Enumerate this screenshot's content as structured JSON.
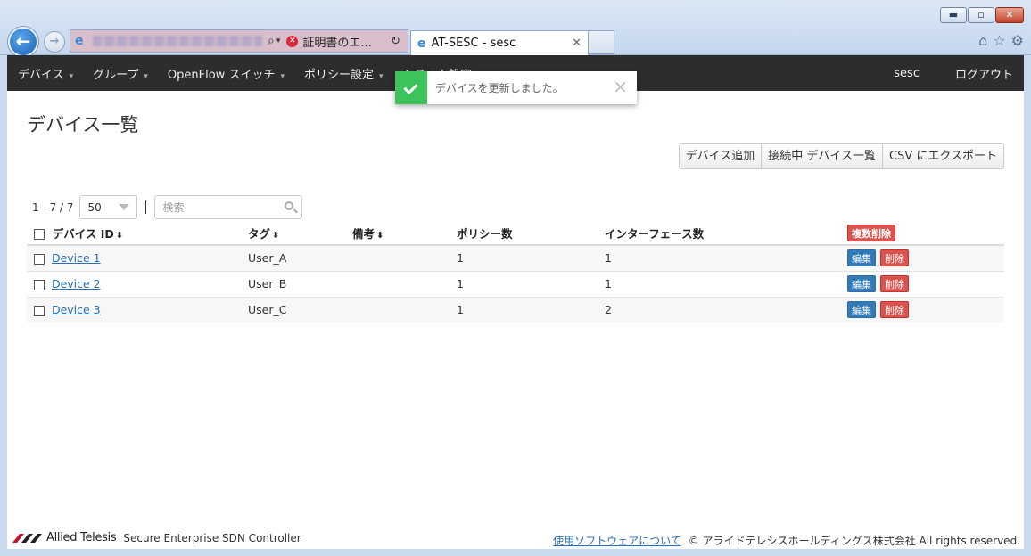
{
  "browser": {
    "window_controls": {
      "minimize": "▬",
      "maximize": "▫",
      "close": "✕"
    },
    "address_bar": {
      "cert_error_label": "証明書のエ...",
      "search_glyph": "⌕",
      "dropdown_glyph": "▾",
      "refresh_glyph": "↻",
      "error_glyph": "✕"
    },
    "tab": {
      "title": "AT-SESC - sesc",
      "close_glyph": "✕"
    },
    "tools": {
      "home": "⌂",
      "favorites": "☆",
      "settings": "⚙"
    }
  },
  "navbar": {
    "menu": [
      {
        "label": "デバイス"
      },
      {
        "label": "グループ"
      },
      {
        "label": "OpenFlow スイッチ"
      },
      {
        "label": "ポリシー設定"
      },
      {
        "label": "システム設定"
      }
    ],
    "user": "sesc",
    "logout": "ログアウト"
  },
  "toast": {
    "message": "デバイスを更新しました。",
    "close_glyph": "×"
  },
  "page": {
    "title": "デバイス一覧",
    "buttons": {
      "add": "デバイス追加",
      "connected": "接続中 デバイス一覧",
      "csv": "CSV にエクスポート"
    },
    "count": "1 - 7 / 7",
    "page_size": "50",
    "search_placeholder": "検索"
  },
  "table": {
    "headers": {
      "device_id": "デバイス ID",
      "tag": "タグ",
      "note": "備考",
      "policy_count": "ポリシー数",
      "interface_count": "インターフェース数",
      "bulk_delete": "複数削除"
    },
    "sort_glyph": "⬍",
    "edit_label": "編集",
    "delete_label": "削除",
    "rows": [
      {
        "device": "Device 1",
        "tag": "User_A",
        "note": "",
        "policies": "1",
        "interfaces": "1"
      },
      {
        "device": "Device 2",
        "tag": "User_B",
        "note": "",
        "policies": "1",
        "interfaces": "1"
      },
      {
        "device": "Device 3",
        "tag": "User_C",
        "note": "",
        "policies": "1",
        "interfaces": "2"
      }
    ]
  },
  "footer": {
    "brand": "Allied Telesis",
    "product": "Secure Enterprise SDN Controller",
    "software_link": "使用ソフトウェアについて",
    "copyright": "© アライドテレシスホールディングス株式会社 All rights reserved."
  },
  "colors": {
    "navbar": "#2d2d2d",
    "success": "#3cc35a",
    "edit": "#337ab7",
    "delete": "#d9534f",
    "link": "#2a6fb7"
  }
}
